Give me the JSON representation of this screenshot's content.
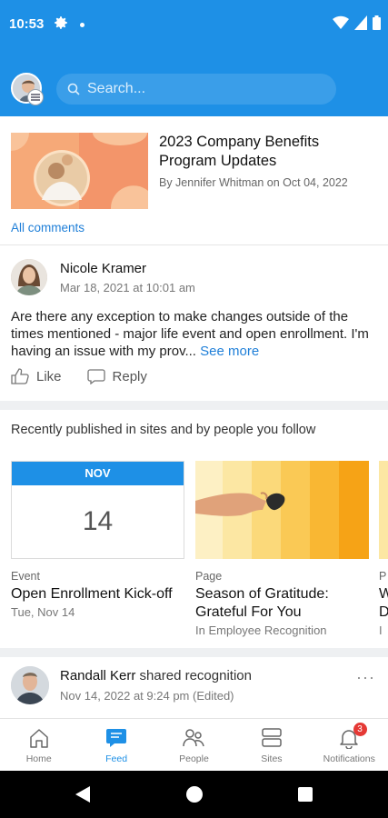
{
  "status_bar": {
    "time": "10:53"
  },
  "header": {
    "search_placeholder": "Search..."
  },
  "article": {
    "title": "2023 Company Benefits Program Updates",
    "byline": "By Jennifer Whitman on Oct 04, 2022",
    "all_comments": "All comments"
  },
  "post": {
    "author": "Nicole Kramer",
    "time": "Mar 18, 2021 at 10:01 am",
    "body": "Are there any exception to make changes outside of the times mentioned - major life event and open enrollment. I'm having an issue with my prov...",
    "see_more": "See more",
    "like_label": "Like",
    "reply_label": "Reply"
  },
  "recent": {
    "title": "Recently published in sites and by people you follow",
    "tiles": [
      {
        "month": "NOV",
        "day": "14",
        "type": "Event",
        "title": "Open Enrollment Kick-off",
        "meta": "Tue, Nov 14"
      },
      {
        "type": "Page",
        "title": "Season of Gratitude: Grateful For You",
        "meta": "In Employee Recognition"
      },
      {
        "type": "P",
        "title": "W D",
        "meta": "I"
      }
    ]
  },
  "recognition": {
    "author": "Randall Kerr",
    "action": " shared recognition",
    "time": "Nov 14, 2022 at 9:24 pm (Edited)",
    "more": "···"
  },
  "bottom_nav": {
    "items": [
      {
        "label": "Home",
        "icon": "home-icon"
      },
      {
        "label": "Feed",
        "icon": "feed-icon"
      },
      {
        "label": "People",
        "icon": "people-icon"
      },
      {
        "label": "Sites",
        "icon": "sites-icon"
      },
      {
        "label": "Notifications",
        "icon": "bell-icon"
      }
    ],
    "active": "Feed",
    "notification_count": "3"
  },
  "colors": {
    "brand": "#1e90e6",
    "link": "#1f7fd8",
    "badge": "#e53935"
  }
}
